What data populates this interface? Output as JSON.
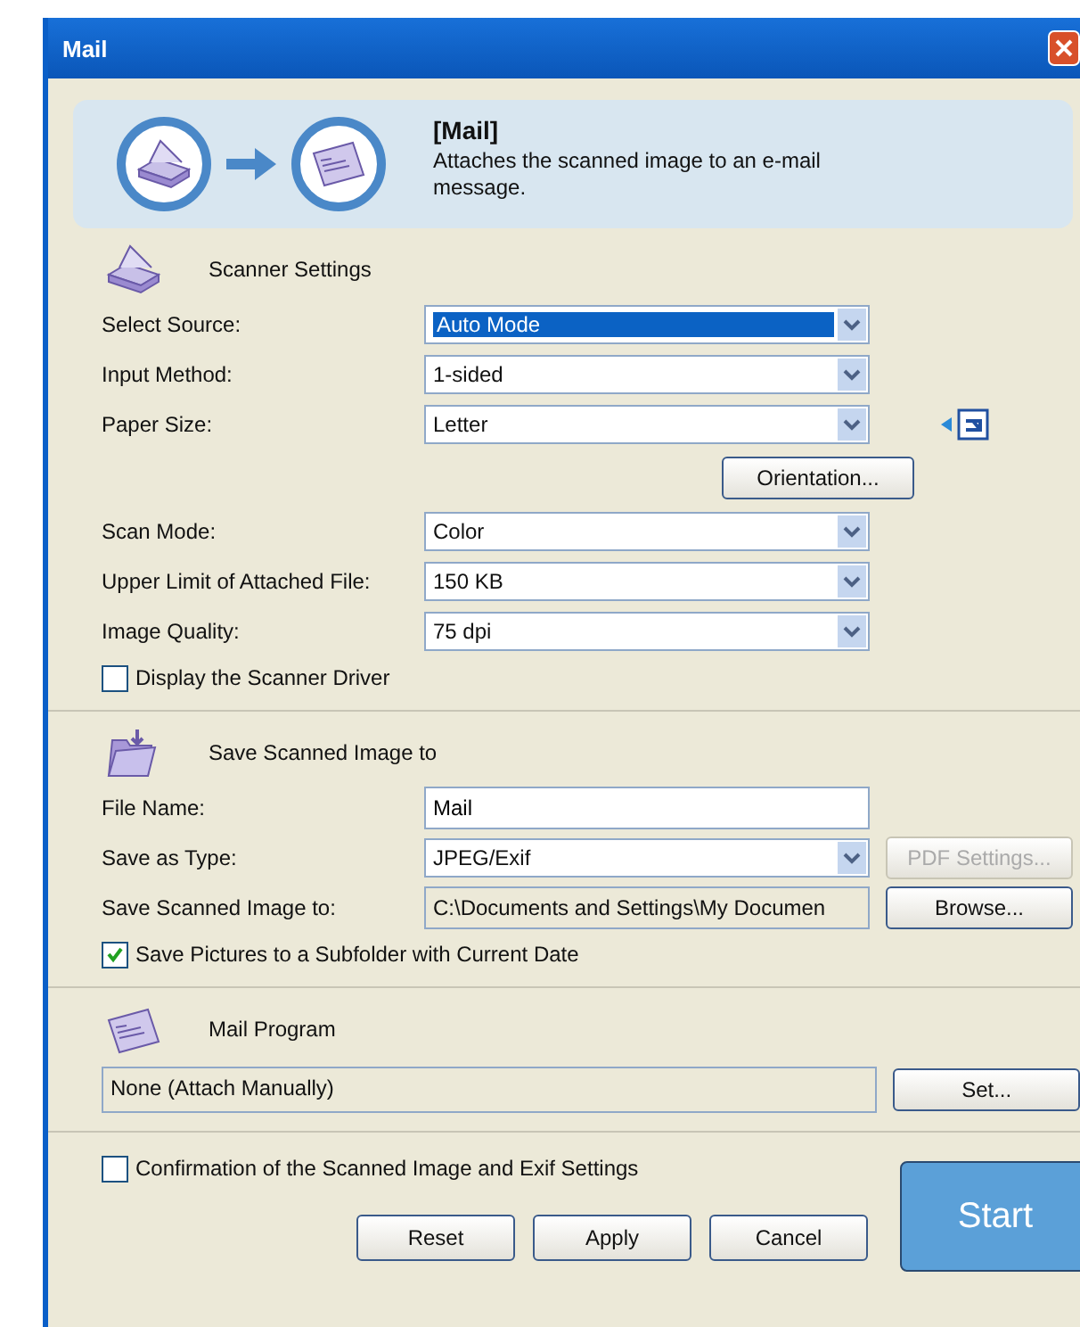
{
  "window": {
    "title": "Mail"
  },
  "banner": {
    "title": "[Mail]",
    "description": "Attaches the scanned image to an e-mail message."
  },
  "scanner_settings": {
    "heading": "Scanner Settings",
    "fields": [
      {
        "label": "Select Source:",
        "kind": "combo",
        "value": "Auto Mode",
        "selected": true
      },
      {
        "label": "Input Method:",
        "kind": "combo",
        "value": "1-sided",
        "selected": false
      },
      {
        "label": "Paper Size:",
        "kind": "combo",
        "value": "Letter",
        "selected": false
      },
      {
        "label": "Scan Mode:",
        "kind": "combo",
        "value": "Color",
        "selected": false
      },
      {
        "label": "Upper Limit of Attached File:",
        "kind": "combo",
        "value": "150 KB",
        "selected": false
      },
      {
        "label": "Image Quality:",
        "kind": "combo",
        "value": "75 dpi",
        "selected": false
      }
    ],
    "orientation_button": "Orientation...",
    "display_driver": {
      "label": "Display the Scanner Driver",
      "checked": false
    }
  },
  "save": {
    "heading": "Save Scanned Image to",
    "fields": [
      {
        "label": "File Name:",
        "kind": "text",
        "value": "Mail"
      },
      {
        "label": "Save as Type:",
        "kind": "combo",
        "value": "JPEG/Exif",
        "button": {
          "label": "PDF Settings...",
          "disabled": true
        }
      },
      {
        "label": "Save Scanned Image to:",
        "kind": "readonly",
        "value": "C:\\Documents and Settings\\My Documen",
        "button": {
          "label": "Browse...",
          "disabled": false
        }
      }
    ],
    "subfolder": {
      "label": "Save Pictures to a Subfolder with Current Date",
      "checked": true
    }
  },
  "mail_program": {
    "heading": "Mail Program",
    "value": "None (Attach Manually)",
    "button": "Set..."
  },
  "confirmation": {
    "label": "Confirmation of the Scanned Image and Exif Settings",
    "checked": false
  },
  "buttons": [
    "Reset",
    "Apply",
    "Cancel"
  ],
  "start": "Start"
}
